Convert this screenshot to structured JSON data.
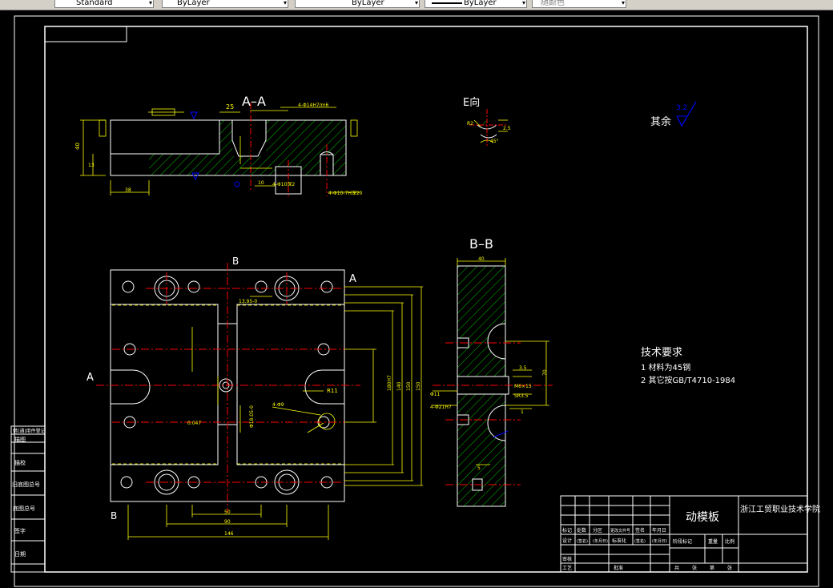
{
  "toolbar": {
    "style_value": "Standard",
    "layer_value": "ByLayer",
    "linetype_value": "ByLayer",
    "lineweight_value": "ByLayer",
    "plotstyle_value": "随颜色"
  },
  "views": {
    "aa": {
      "title": "A–A",
      "dim_25": "25",
      "dim_40": "40",
      "dim_13": "13",
      "dim_38": "38",
      "dim_10": "10",
      "note_hole": "4-Φ14H7/m6",
      "note_hole2": "4-Φ10-7H深20",
      "note_b": "4-Φ10深2"
    },
    "e": {
      "title": "E向",
      "dim_r": "R2",
      "dim_2": "2.5",
      "dim_ang": "45°"
    },
    "bb": {
      "title": "B–B",
      "dim_top": "40",
      "dim_70": "70",
      "dim_35": "3.5",
      "dim_1": "1",
      "dim_5": "5",
      "note_left": "4-Φ21H7",
      "note_phi": "Φ11",
      "note_m": "M6×15",
      "note_s": "SR3.5"
    },
    "plan": {
      "mark_a_right": "A",
      "mark_a_left": "A",
      "mark_b_top": "B",
      "mark_b_bottom": "B",
      "dim_146": "146",
      "dim_90": "90",
      "dim_50": "50",
      "dim_vert": [
        "180H7",
        "140",
        "150",
        "150",
        "146"
      ],
      "note_r": "R11",
      "note_phi": "4-Φ9",
      "note_side": "Φ18.05-0",
      "note_left": "0.047",
      "note_top": "13.95-0"
    },
    "surface": {
      "label": "其余",
      "roughness": "3.2"
    }
  },
  "tech_req": {
    "title": "技术要求",
    "items": [
      "1  材料为45钢",
      "2  其它按GB/T4710-1984"
    ]
  },
  "title_block": {
    "part_name": "动模板",
    "school": "浙江工贸职业技术学院",
    "header_cells": [
      "标记",
      "处数",
      "分区",
      "更改文件号",
      "签名",
      "年月日"
    ],
    "row_labels": [
      "设计",
      "审核",
      "工艺"
    ],
    "sig_date": [
      "(签名)",
      "(年月日)",
      "标准化",
      "(签名)",
      "(年月日)"
    ],
    "stage_labels": [
      "阶段标记",
      "重量",
      "比例"
    ],
    "sheet_labels": [
      "共",
      "张",
      "第",
      "张"
    ],
    "approve": "批准"
  },
  "left_strip": {
    "labels": [
      "借(通)用件登记",
      "描图",
      "描校",
      "旧底图总号",
      "底图总号",
      "签字",
      "日期"
    ]
  }
}
